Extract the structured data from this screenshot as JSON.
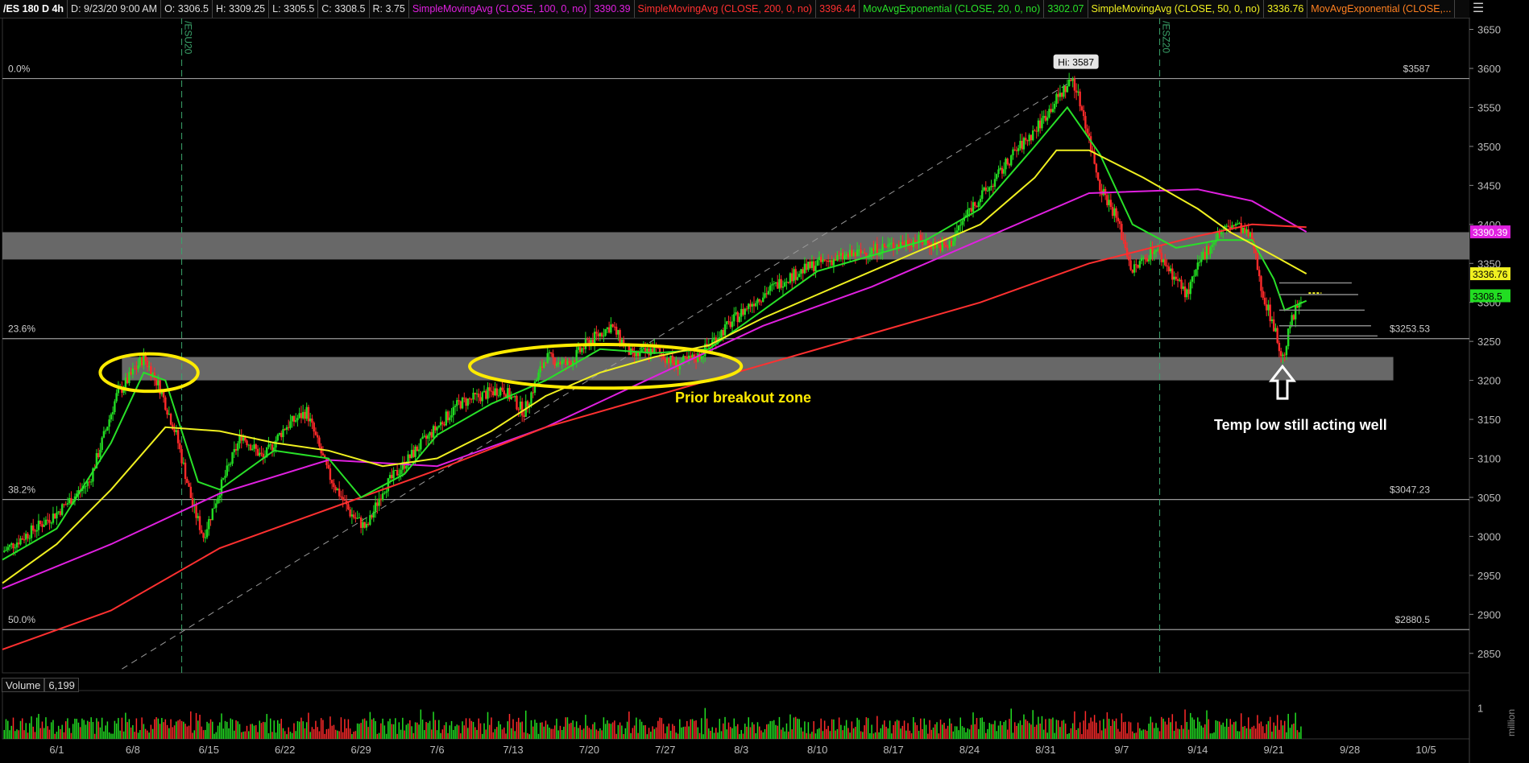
{
  "header": {
    "symbol": "/ES 180 D 4h",
    "date": "D: 9/23/20 9:00 AM",
    "open": "O: 3306.5",
    "high": "H: 3309.25",
    "low": "L: 3305.5",
    "close": "C: 3308.5",
    "range": "R: 3.75",
    "indicators": [
      {
        "label": "SimpleMovingAvg (CLOSE, 100, 0, no)",
        "value": "3390.39",
        "color": "#e020e0"
      },
      {
        "label": "SimpleMovingAvg (CLOSE, 200, 0, no)",
        "value": "3396.44",
        "color": "#ff3030"
      },
      {
        "label": "MovAvgExponential (CLOSE, 20, 0, no)",
        "value": "3302.07",
        "color": "#28e028"
      },
      {
        "label": "SimpleMovingAvg (CLOSE, 50, 0, no)",
        "value": "3336.76",
        "color": "#f0f020"
      },
      {
        "label": "MovAvgExponential (CLOSE,...",
        "value": "",
        "color": "#ff8020"
      }
    ]
  },
  "colors": {
    "background": "#000000",
    "grid": "#2a2a2a",
    "up_candle": "#22dd22",
    "down_candle": "#ff2a2a",
    "zone": "#7a7a7a",
    "ellipse": "#ffeb00",
    "fib_line": "#9a9a9a"
  },
  "icons": {
    "menu": "menu-icon"
  },
  "chart_data": {
    "type": "candlestick",
    "title": "/ES 180 D 4h",
    "ylim": [
      2825,
      3665
    ],
    "y_ticks": [
      2850,
      2900,
      2950,
      3000,
      3050,
      3100,
      3150,
      3200,
      3250,
      3300,
      3350,
      3400,
      3450,
      3500,
      3550,
      3600,
      3650
    ],
    "x_ticks": [
      "6/1",
      "6/8",
      "6/15",
      "6/22",
      "6/29",
      "7/6",
      "7/13",
      "7/20",
      "7/27",
      "8/3",
      "8/10",
      "8/17",
      "8/24",
      "8/31",
      "9/7",
      "9/14",
      "9/21",
      "9/28",
      "10/5"
    ],
    "x_tick_days": [
      0,
      7,
      14,
      21,
      28,
      35,
      42,
      49,
      56,
      63,
      70,
      77,
      84,
      91,
      98,
      105,
      112,
      119,
      126
    ],
    "xlim_days": [
      -5,
      130
    ],
    "last_bar_day": 114.5,
    "price_path": [
      [
        -5,
        2980
      ],
      [
        0,
        3030
      ],
      [
        3,
        3070
      ],
      [
        5.5,
        3180
      ],
      [
        8,
        3230
      ],
      [
        9.5,
        3190
      ],
      [
        11,
        3130
      ],
      [
        12.5,
        3040
      ],
      [
        13.5,
        3000
      ],
      [
        15,
        3060
      ],
      [
        17,
        3130
      ],
      [
        19,
        3100
      ],
      [
        21,
        3140
      ],
      [
        23,
        3160
      ],
      [
        25,
        3080
      ],
      [
        27,
        3030
      ],
      [
        28.5,
        3010
      ],
      [
        30,
        3060
      ],
      [
        33,
        3110
      ],
      [
        35,
        3140
      ],
      [
        37,
        3170
      ],
      [
        39,
        3180
      ],
      [
        41,
        3190
      ],
      [
        43,
        3160
      ],
      [
        45,
        3230
      ],
      [
        47,
        3220
      ],
      [
        49,
        3250
      ],
      [
        51,
        3270
      ],
      [
        53,
        3230
      ],
      [
        55,
        3240
      ],
      [
        57,
        3220
      ],
      [
        59,
        3230
      ],
      [
        61,
        3260
      ],
      [
        64,
        3300
      ],
      [
        67,
        3330
      ],
      [
        70,
        3350
      ],
      [
        73,
        3360
      ],
      [
        76,
        3370
      ],
      [
        79,
        3380
      ],
      [
        82,
        3370
      ],
      [
        84,
        3420
      ],
      [
        86,
        3450
      ],
      [
        88,
        3490
      ],
      [
        90,
        3520
      ],
      [
        92,
        3560
      ],
      [
        93.5,
        3587
      ],
      [
        94.5,
        3540
      ],
      [
        96,
        3450
      ],
      [
        97.5,
        3410
      ],
      [
        99,
        3340
      ],
      [
        101,
        3370
      ],
      [
        103,
        3330
      ],
      [
        104,
        3310
      ],
      [
        105.5,
        3360
      ],
      [
        107,
        3390
      ],
      [
        108.5,
        3400
      ],
      [
        110,
        3380
      ],
      [
        111,
        3310
      ],
      [
        112,
        3270
      ],
      [
        112.8,
        3225
      ],
      [
        113.5,
        3270
      ],
      [
        114.5,
        3308.5
      ]
    ],
    "series": [
      {
        "name": "SimpleMovingAvg (CLOSE, 100, 0, no)",
        "color": "#e020e0",
        "last": 3390.39,
        "points": [
          [
            -5,
            2933
          ],
          [
            5,
            2990
          ],
          [
            15,
            3055
          ],
          [
            25,
            3098
          ],
          [
            35,
            3090
          ],
          [
            45,
            3140
          ],
          [
            55,
            3205
          ],
          [
            65,
            3270
          ],
          [
            75,
            3320
          ],
          [
            85,
            3380
          ],
          [
            95,
            3440
          ],
          [
            105,
            3445
          ],
          [
            110,
            3430
          ],
          [
            115,
            3390.39
          ]
        ]
      },
      {
        "name": "SimpleMovingAvg (CLOSE, 200, 0, no)",
        "color": "#ff3030",
        "last": 3396.44,
        "points": [
          [
            -5,
            2855
          ],
          [
            5,
            2905
          ],
          [
            15,
            2985
          ],
          [
            25,
            3035
          ],
          [
            35,
            3085
          ],
          [
            45,
            3140
          ],
          [
            55,
            3180
          ],
          [
            65,
            3220
          ],
          [
            75,
            3260
          ],
          [
            85,
            3300
          ],
          [
            95,
            3350
          ],
          [
            105,
            3385
          ],
          [
            110,
            3400
          ],
          [
            115,
            3396.44
          ]
        ]
      },
      {
        "name": "MovAvgExponential (CLOSE, 20, 0, no)",
        "color": "#28e028",
        "last": 3302.07,
        "points": [
          [
            -5,
            2970
          ],
          [
            0,
            3010
          ],
          [
            5,
            3120
          ],
          [
            8,
            3210
          ],
          [
            10,
            3200
          ],
          [
            13,
            3070
          ],
          [
            15,
            3060
          ],
          [
            20,
            3110
          ],
          [
            25,
            3100
          ],
          [
            28,
            3050
          ],
          [
            32,
            3080
          ],
          [
            35,
            3130
          ],
          [
            40,
            3170
          ],
          [
            45,
            3200
          ],
          [
            50,
            3240
          ],
          [
            55,
            3235
          ],
          [
            60,
            3240
          ],
          [
            65,
            3290
          ],
          [
            70,
            3340
          ],
          [
            75,
            3360
          ],
          [
            80,
            3380
          ],
          [
            85,
            3420
          ],
          [
            90,
            3500
          ],
          [
            93,
            3550
          ],
          [
            96,
            3490
          ],
          [
            99,
            3400
          ],
          [
            103,
            3370
          ],
          [
            107,
            3380
          ],
          [
            110,
            3380
          ],
          [
            112,
            3330
          ],
          [
            113,
            3290
          ],
          [
            115,
            3302.07
          ]
        ]
      },
      {
        "name": "SimpleMovingAvg (CLOSE, 50, 0, no)",
        "color": "#f0f020",
        "last": 3336.76,
        "points": [
          [
            -5,
            2940
          ],
          [
            0,
            2990
          ],
          [
            5,
            3060
          ],
          [
            10,
            3140
          ],
          [
            15,
            3135
          ],
          [
            20,
            3120
          ],
          [
            25,
            3110
          ],
          [
            30,
            3090
          ],
          [
            35,
            3100
          ],
          [
            40,
            3135
          ],
          [
            45,
            3180
          ],
          [
            50,
            3210
          ],
          [
            55,
            3230
          ],
          [
            60,
            3245
          ],
          [
            65,
            3280
          ],
          [
            70,
            3310
          ],
          [
            75,
            3340
          ],
          [
            80,
            3370
          ],
          [
            85,
            3400
          ],
          [
            90,
            3460
          ],
          [
            92,
            3495
          ],
          [
            95,
            3495
          ],
          [
            100,
            3460
          ],
          [
            105,
            3420
          ],
          [
            108,
            3390
          ],
          [
            112,
            3360
          ],
          [
            115,
            3336.76
          ]
        ]
      }
    ],
    "fib_levels": [
      {
        "pct": "0.0%",
        "value": 3587,
        "label": "$3587"
      },
      {
        "pct": "23.6%",
        "value": 3253.53,
        "label": "$3253.53"
      },
      {
        "pct": "38.2%",
        "value": 3047.23,
        "label": "$3047.23"
      },
      {
        "pct": "50.0%",
        "value": 2880.5,
        "label": "$2880.5"
      }
    ],
    "zones": [
      {
        "low": 3355,
        "high": 3390,
        "from": -5,
        "to": 130
      },
      {
        "low": 3200,
        "high": 3230,
        "from": 6,
        "to": 123
      }
    ],
    "ellipses": [
      {
        "x": 8.5,
        "y": 3210,
        "rx": 4.5,
        "ry": 24
      },
      {
        "x": 50.5,
        "y": 3218,
        "rx": 12.5,
        "ry": 28
      }
    ],
    "trendline": {
      "from": [
        6,
        2830
      ],
      "to": [
        93,
        3580
      ]
    },
    "expiry_lines": [
      {
        "day": 11.5,
        "label": "/ESU20"
      },
      {
        "day": 101.5,
        "label": "/ESZ20"
      }
    ],
    "hi_label": {
      "day": 93.5,
      "value": 3587,
      "text": "Hi: 3587"
    },
    "price_badges": [
      {
        "value": 3390.39,
        "text": "3390.39",
        "bg": "#e020e0",
        "fg": "#ffffff"
      },
      {
        "value": 3336.76,
        "text": "3336.76",
        "bg": "#f0f020",
        "fg": "#000000"
      },
      {
        "value": 3308.5,
        "text": "3308.5",
        "bg": "#22dd22",
        "fg": "#000000"
      }
    ],
    "volume": {
      "label": "Volume",
      "value": "6,199",
      "ylim": [
        0,
        1.5
      ],
      "y_ticks": [
        1
      ],
      "unit_label": "million"
    },
    "annotations": [
      {
        "text": "Prior breakout zone"
      },
      {
        "text": "Temp low still acting well"
      }
    ]
  }
}
